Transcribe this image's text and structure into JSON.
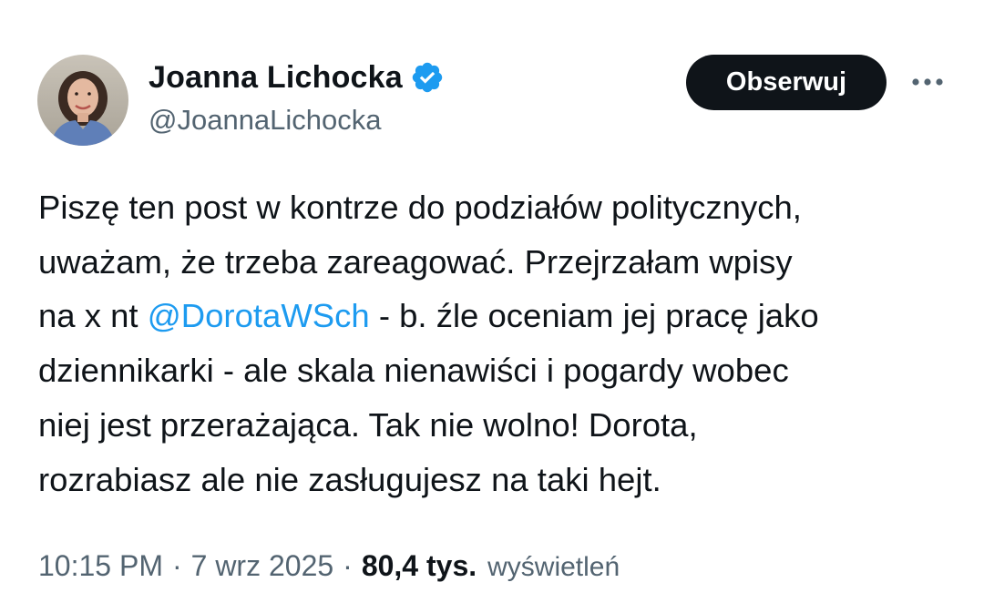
{
  "author": {
    "display_name": "Joanna Lichocka",
    "handle": "@JoannaLichocka",
    "verified": true,
    "avatar_icon": "profile-photo"
  },
  "actions": {
    "follow_label": "Obserwuj",
    "more_icon": "more-horizontal-icon"
  },
  "post": {
    "line_1": "Piszę ten post w kontrze do podziałów politycznych,",
    "line_2": "uważam, że trzeba zareagować. Przejrzałam wpisy",
    "line_3_pre": "na x nt ",
    "mention": "@DorotaWSch",
    "line_3_post": " - b. źle oceniam jej pracę jako",
    "line_4": "dziennikarki - ale skala nienawiści i pogardy wobec",
    "line_5": "niej jest przerażająca. Tak nie wolno! Dorota,",
    "line_6": "rozrabiasz ale nie zasługujesz na taki hejt."
  },
  "meta": {
    "time": "10:15 PM",
    "separator": "·",
    "date": "7 wrz 2025",
    "views_count": "80,4 tys.",
    "views_label": "wyświetleń"
  },
  "colors": {
    "text": "#0f1419",
    "secondary": "#536471",
    "link": "#1d9bf0",
    "verified": "#1d9bf0",
    "button_bg": "#0f1419"
  }
}
